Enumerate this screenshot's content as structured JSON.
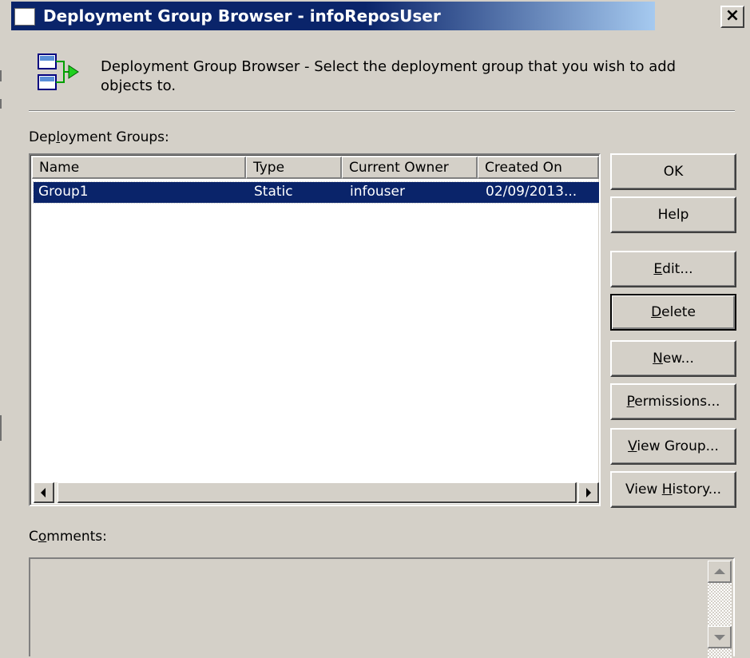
{
  "window": {
    "title": "Deployment Group Browser - infoReposUser",
    "close_glyph": "×"
  },
  "header": {
    "description": "Deployment Group Browser - Select the deployment group that you wish to add objects to.",
    "icon": "deployment-group-icon"
  },
  "groups_label": {
    "pre": "Dep",
    "accel": "l",
    "post": "oyment Groups:"
  },
  "table": {
    "columns": [
      "Name",
      "Type",
      "Current Owner",
      "Created On"
    ],
    "rows": [
      {
        "name": "Group1",
        "type": "Static",
        "owner": "infouser",
        "created": "02/09/2013..."
      }
    ],
    "selected_row": 0
  },
  "buttons": {
    "ok": {
      "label": "OK"
    },
    "help": {
      "label": "Help"
    },
    "edit": {
      "accel": "E",
      "post": "dit..."
    },
    "delete": {
      "accel": "D",
      "post": "elete"
    },
    "new": {
      "accel": "N",
      "post": "ew..."
    },
    "permissions": {
      "accel": "P",
      "post": "ermissions..."
    },
    "view_group": {
      "accel": "V",
      "post": "iew Group..."
    },
    "view_history": {
      "pre": "View ",
      "accel": "H",
      "post": "istory..."
    }
  },
  "comments_label": {
    "pre": "C",
    "accel": "o",
    "post": "mments:"
  },
  "comments_value": "",
  "colors": {
    "title_active": "#0a246a",
    "title_fade": "#a6caf0",
    "selection": "#0a246a",
    "face": "#d4d0c8"
  }
}
